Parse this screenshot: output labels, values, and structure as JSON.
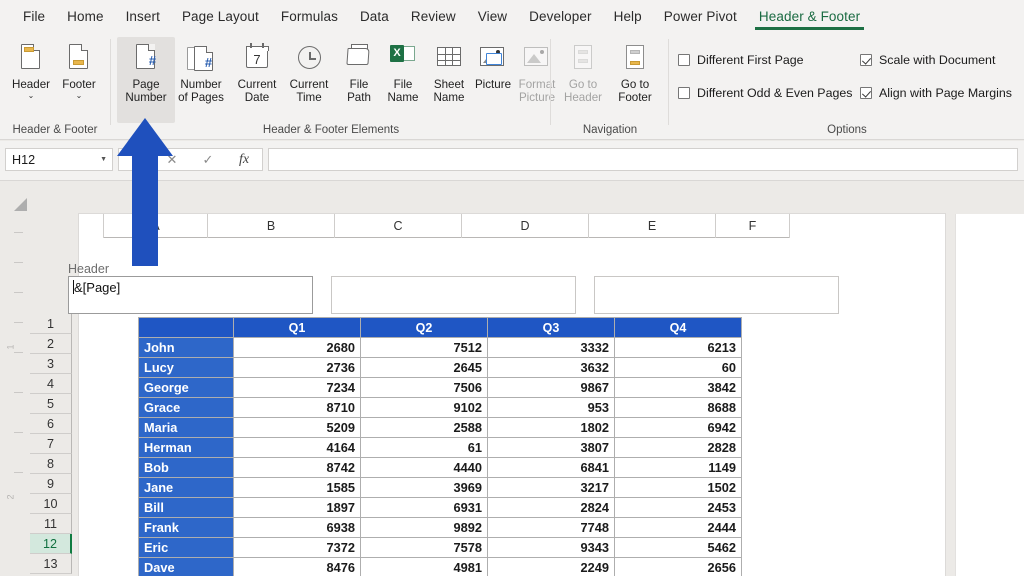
{
  "ribbon": {
    "tabs": [
      {
        "label": "File",
        "active": false
      },
      {
        "label": "Home",
        "active": false
      },
      {
        "label": "Insert",
        "active": false
      },
      {
        "label": "Page Layout",
        "active": false
      },
      {
        "label": "Formulas",
        "active": false
      },
      {
        "label": "Data",
        "active": false
      },
      {
        "label": "Review",
        "active": false
      },
      {
        "label": "View",
        "active": false
      },
      {
        "label": "Developer",
        "active": false
      },
      {
        "label": "Help",
        "active": false
      },
      {
        "label": "Power Pivot",
        "active": false
      },
      {
        "label": "Header & Footer",
        "active": true
      }
    ],
    "accent_color": "#1d7044",
    "groups": {
      "header_footer": {
        "label": "Header & Footer",
        "buttons": [
          {
            "label_line1": "Header",
            "label_line2": "",
            "caret": "⌄",
            "icon": "header-page-icon",
            "state": "normal"
          },
          {
            "label_line1": "Footer",
            "label_line2": "",
            "caret": "⌄",
            "icon": "footer-page-icon",
            "state": "normal"
          }
        ]
      },
      "elements": {
        "label": "Header & Footer Elements",
        "buttons": [
          {
            "label_line1": "Page",
            "label_line2": "Number",
            "icon": "page-number-icon",
            "state": "selected"
          },
          {
            "label_line1": "Number",
            "label_line2": "of Pages",
            "icon": "number-of-pages-icon",
            "state": "normal"
          },
          {
            "label_line1": "Current",
            "label_line2": "Date",
            "icon": "calendar-icon",
            "state": "normal"
          },
          {
            "label_line1": "Current",
            "label_line2": "Time",
            "icon": "clock-icon",
            "state": "normal"
          },
          {
            "label_line1": "File",
            "label_line2": "Path",
            "icon": "folder-icon",
            "state": "normal"
          },
          {
            "label_line1": "File",
            "label_line2": "Name",
            "icon": "excel-file-icon",
            "state": "normal"
          },
          {
            "label_line1": "Sheet",
            "label_line2": "Name",
            "icon": "sheet-grid-icon",
            "state": "normal"
          },
          {
            "label_line1": "Picture",
            "label_line2": "",
            "icon": "picture-icon",
            "state": "normal"
          },
          {
            "label_line1": "Format",
            "label_line2": "Picture",
            "icon": "format-picture-icon",
            "state": "disabled"
          }
        ]
      },
      "navigation": {
        "label": "Navigation",
        "buttons": [
          {
            "label_line1": "Go to",
            "label_line2": "Header",
            "icon": "go-to-header-icon",
            "state": "disabled"
          },
          {
            "label_line1": "Go to",
            "label_line2": "Footer",
            "icon": "go-to-footer-icon",
            "state": "normal"
          }
        ]
      },
      "options": {
        "label": "Options",
        "checkboxes": [
          {
            "label": "Different First Page",
            "checked": false
          },
          {
            "label": "Different Odd & Even Pages",
            "checked": false
          },
          {
            "label": "Scale with Document",
            "checked": true
          },
          {
            "label": "Align with Page Margins",
            "checked": true
          }
        ]
      }
    }
  },
  "formula_bar": {
    "name_box_value": "H12",
    "cancel_icon": "✕",
    "confirm_icon": "✓",
    "function_icon": "fx",
    "formula_value": ""
  },
  "sheet": {
    "column_headers": [
      "A",
      "B",
      "C",
      "D",
      "E",
      "F"
    ],
    "row_headers": [
      "1",
      "2",
      "3",
      "4",
      "5",
      "6",
      "7",
      "8",
      "9",
      "10",
      "11",
      "12",
      "13"
    ],
    "active_row": "12",
    "header_section": {
      "label": "Header",
      "left_box_value": "&[Page]",
      "center_box_value": "",
      "right_box_value": ""
    },
    "table": {
      "columns": [
        "",
        "Q1",
        "Q2",
        "Q3",
        "Q4"
      ],
      "rows": [
        {
          "name": "John",
          "values": [
            "2680",
            "7512",
            "3332",
            "6213"
          ]
        },
        {
          "name": "Lucy",
          "values": [
            "2736",
            "2645",
            "3632",
            "60"
          ]
        },
        {
          "name": "George",
          "values": [
            "7234",
            "7506",
            "9867",
            "3842"
          ]
        },
        {
          "name": "Grace",
          "values": [
            "8710",
            "9102",
            "953",
            "8688"
          ]
        },
        {
          "name": "Maria",
          "values": [
            "5209",
            "2588",
            "1802",
            "6942"
          ]
        },
        {
          "name": "Herman",
          "values": [
            "4164",
            "61",
            "3807",
            "2828"
          ]
        },
        {
          "name": "Bob",
          "values": [
            "8742",
            "4440",
            "6841",
            "1149"
          ]
        },
        {
          "name": "Jane",
          "values": [
            "1585",
            "3969",
            "3217",
            "1502"
          ]
        },
        {
          "name": "Bill",
          "values": [
            "1897",
            "6931",
            "2824",
            "2453"
          ]
        },
        {
          "name": "Frank",
          "values": [
            "6938",
            "9892",
            "7748",
            "2444"
          ]
        },
        {
          "name": "Eric",
          "values": [
            "7372",
            "7578",
            "9343",
            "5462"
          ]
        },
        {
          "name": "Dave",
          "values": [
            "8476",
            "4981",
            "2249",
            "2656"
          ]
        }
      ],
      "header_color": "#1f56c4",
      "name_color": "#2e67c9"
    }
  },
  "annotation": {
    "arrow_color": "#1f50bd",
    "arrow_direction": "up",
    "points_to": "Page Number"
  }
}
